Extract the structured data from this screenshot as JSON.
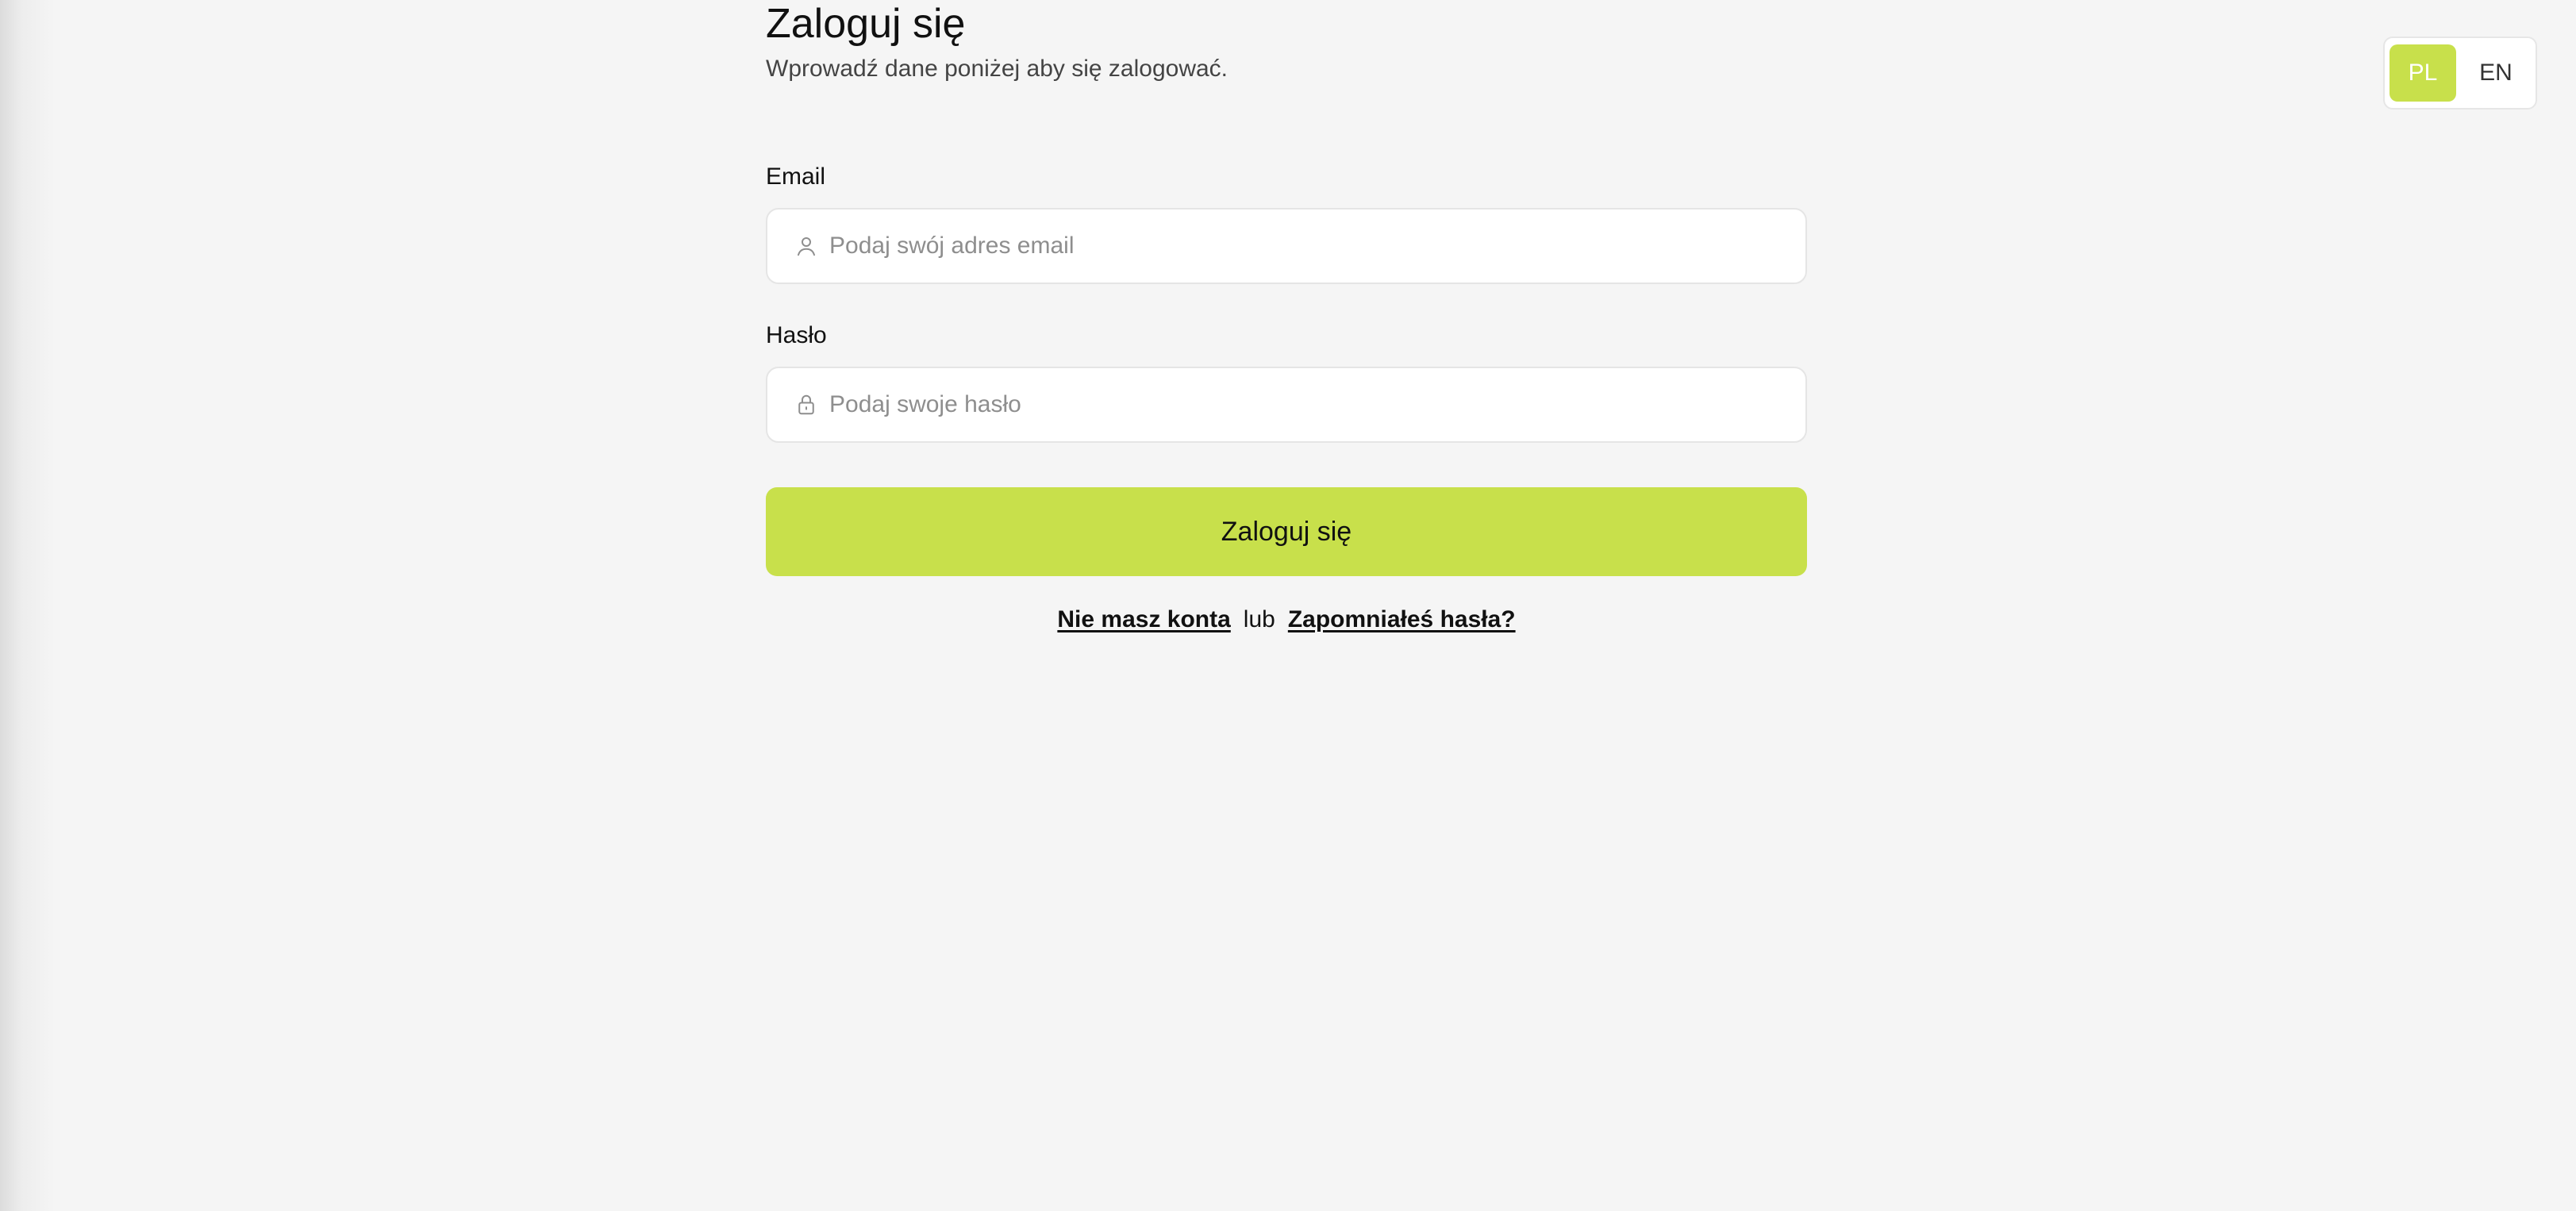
{
  "header": {
    "title": "Zaloguj się",
    "subtitle": "Wprowadź dane poniżej aby się zalogować."
  },
  "language_switcher": {
    "options": [
      {
        "code": "PL",
        "active": true
      },
      {
        "code": "EN",
        "active": false
      }
    ]
  },
  "form": {
    "email": {
      "label": "Email",
      "placeholder": "Podaj swój adres email",
      "value": "",
      "icon": "user-icon"
    },
    "password": {
      "label": "Hasło",
      "placeholder": "Podaj swoje hasło",
      "value": "",
      "icon": "lock-icon"
    },
    "submit_label": "Zaloguj się"
  },
  "links": {
    "register": "Nie masz konta",
    "separator": "lub",
    "forgot_password": "Zapomniałeś hasła?"
  },
  "colors": {
    "accent": "#c8e04b",
    "background": "#f5f5f5",
    "input_background": "#ffffff",
    "placeholder": "#8e8e8e"
  }
}
